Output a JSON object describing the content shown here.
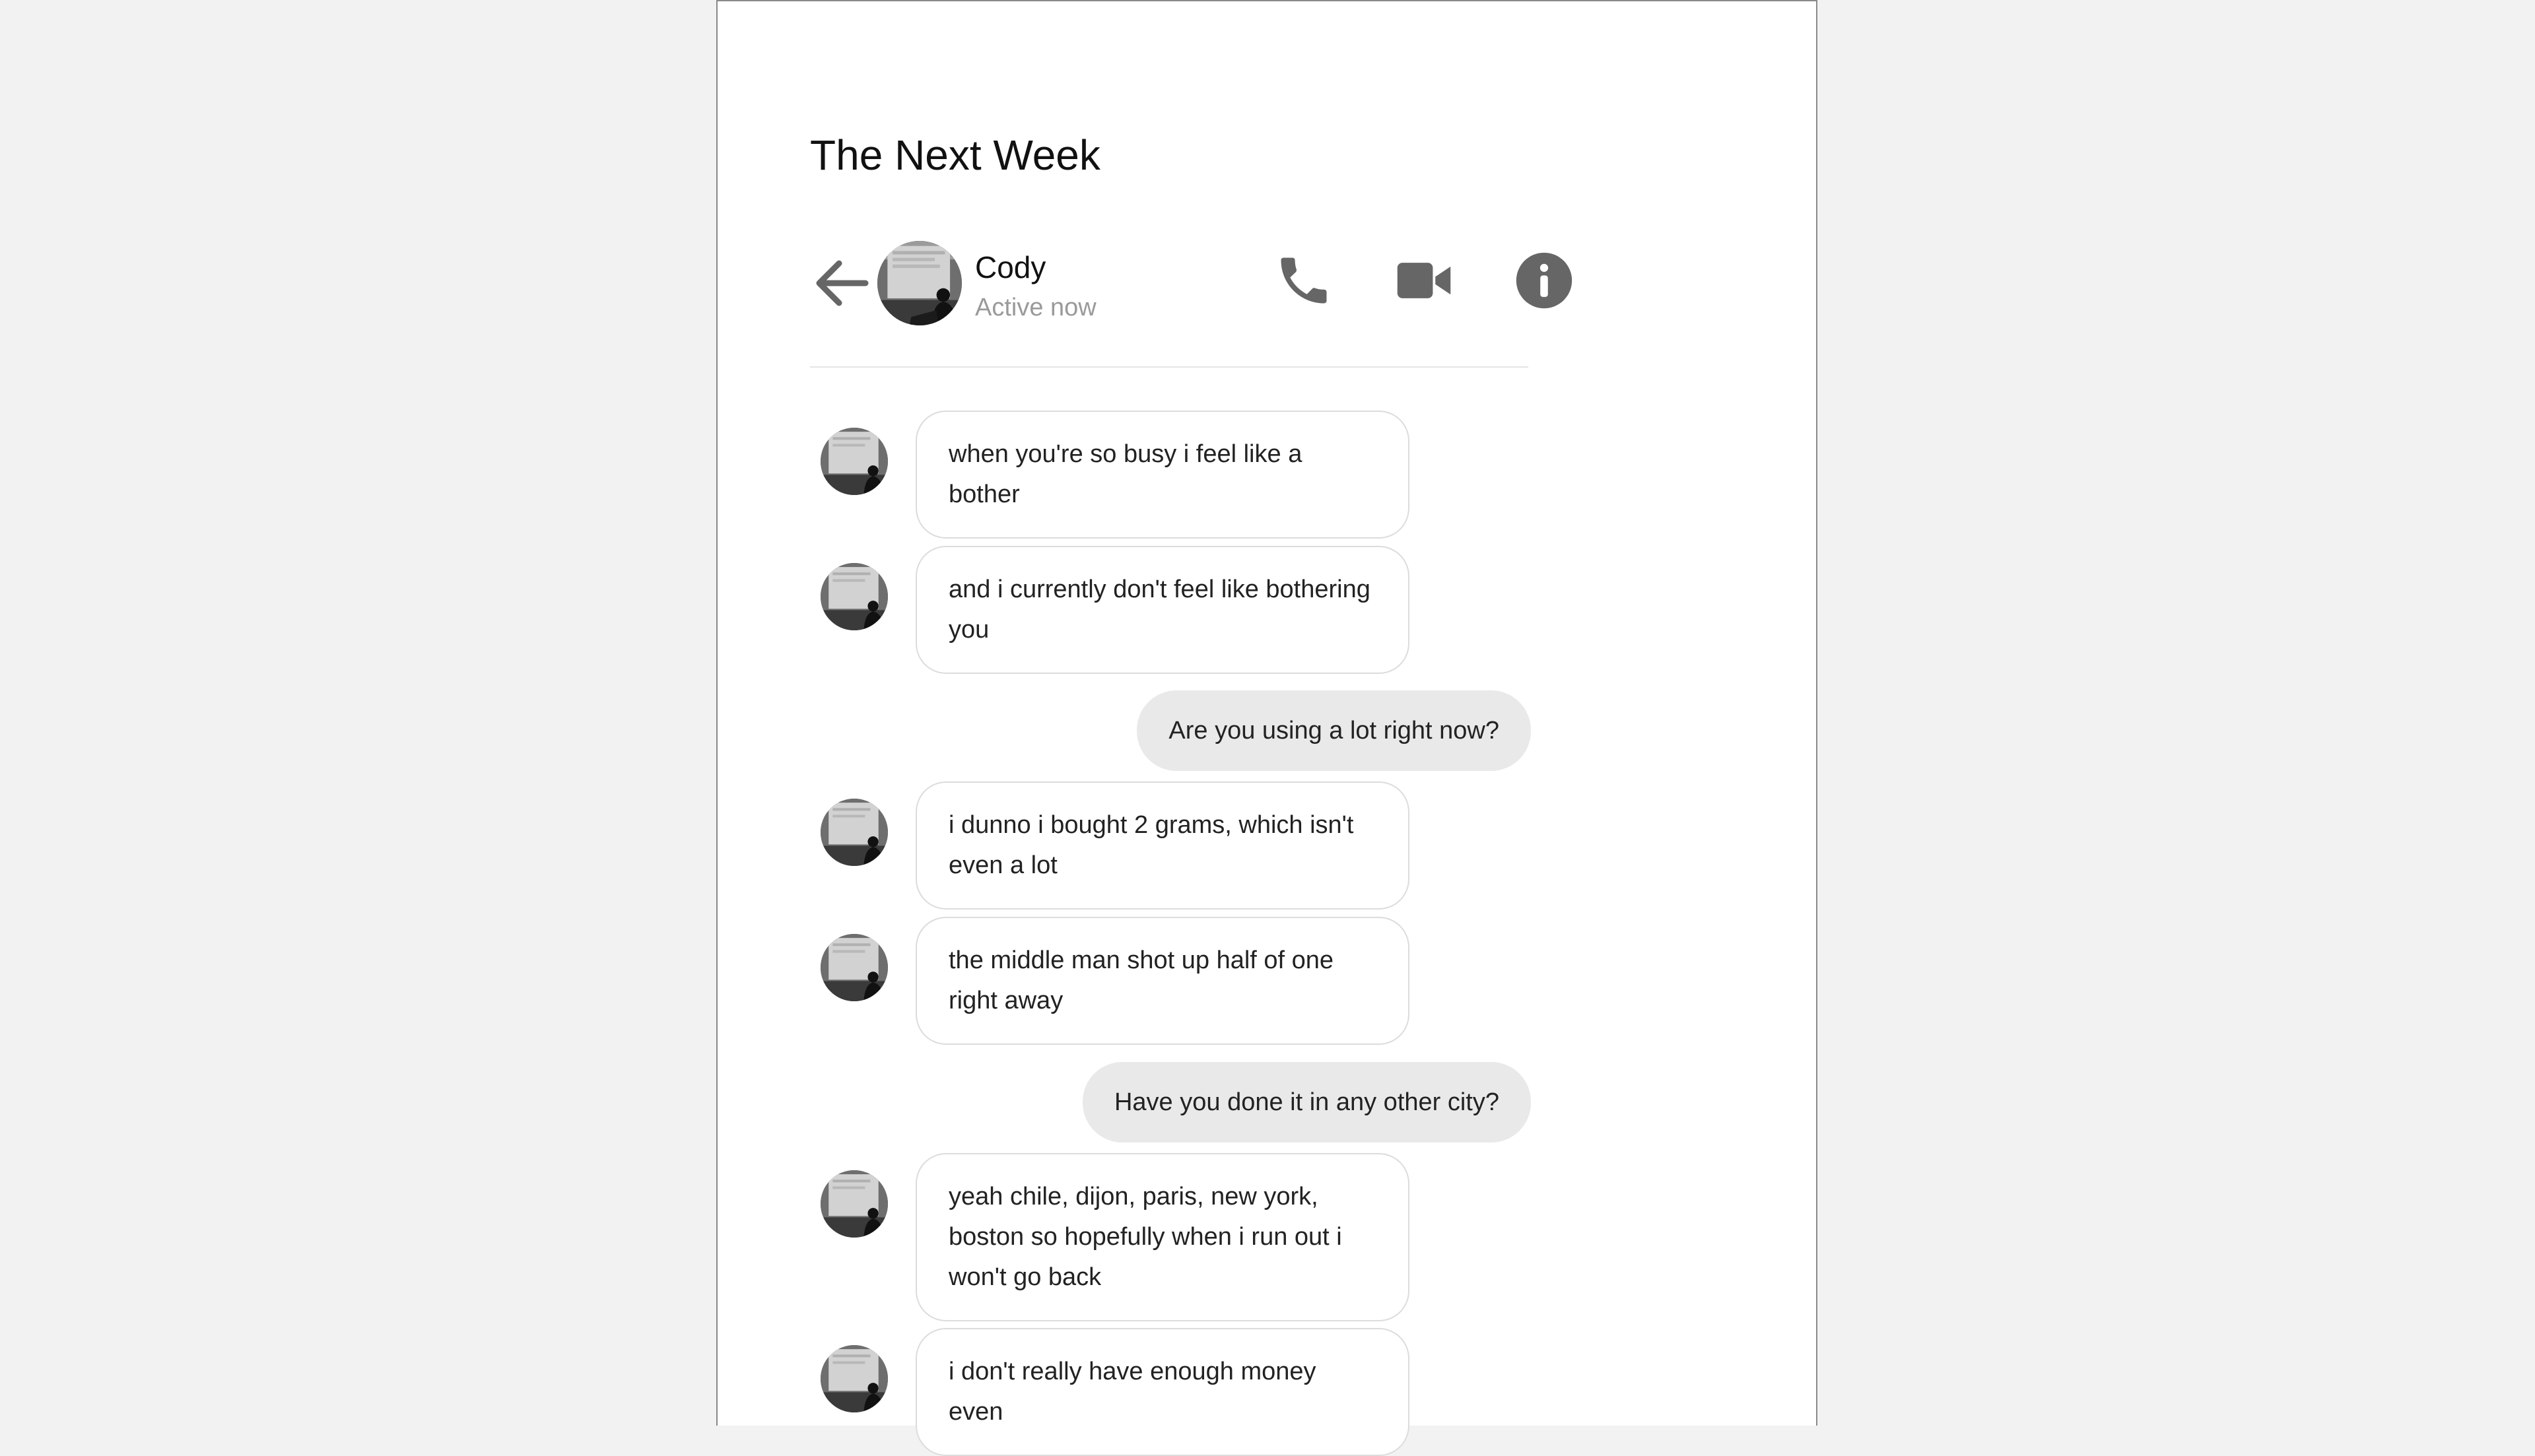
{
  "page_title": "The Next Week",
  "header": {
    "contact_name": "Cody",
    "contact_status": "Active now",
    "icons": [
      "back-arrow-icon",
      "phone-icon",
      "video-camera-icon",
      "info-icon"
    ]
  },
  "messages": [
    {
      "from": "them",
      "text": "when you're so busy i feel like a bother"
    },
    {
      "from": "them",
      "text": "and i currently don't feel like bothering you"
    },
    {
      "from": "me",
      "text": "Are you using a lot right now?"
    },
    {
      "from": "them",
      "text": "i dunno i bought 2 grams, which isn't even a lot"
    },
    {
      "from": "them",
      "text": "the middle man shot up half of one right away"
    },
    {
      "from": "me",
      "text": "Have you done it in any other city?"
    },
    {
      "from": "them",
      "text": "yeah chile, dijon, paris, new york, boston so hopefully when i run out i won't go back"
    },
    {
      "from": "them",
      "text": "i don't really have enough money even"
    }
  ],
  "colors": {
    "background": "#f2f2f2",
    "page": "#ffffff",
    "icon": "#666666",
    "outgoing_bubble": "#e9e9e9",
    "incoming_border": "#dcdcdc",
    "status_text": "#9a9a9a"
  }
}
